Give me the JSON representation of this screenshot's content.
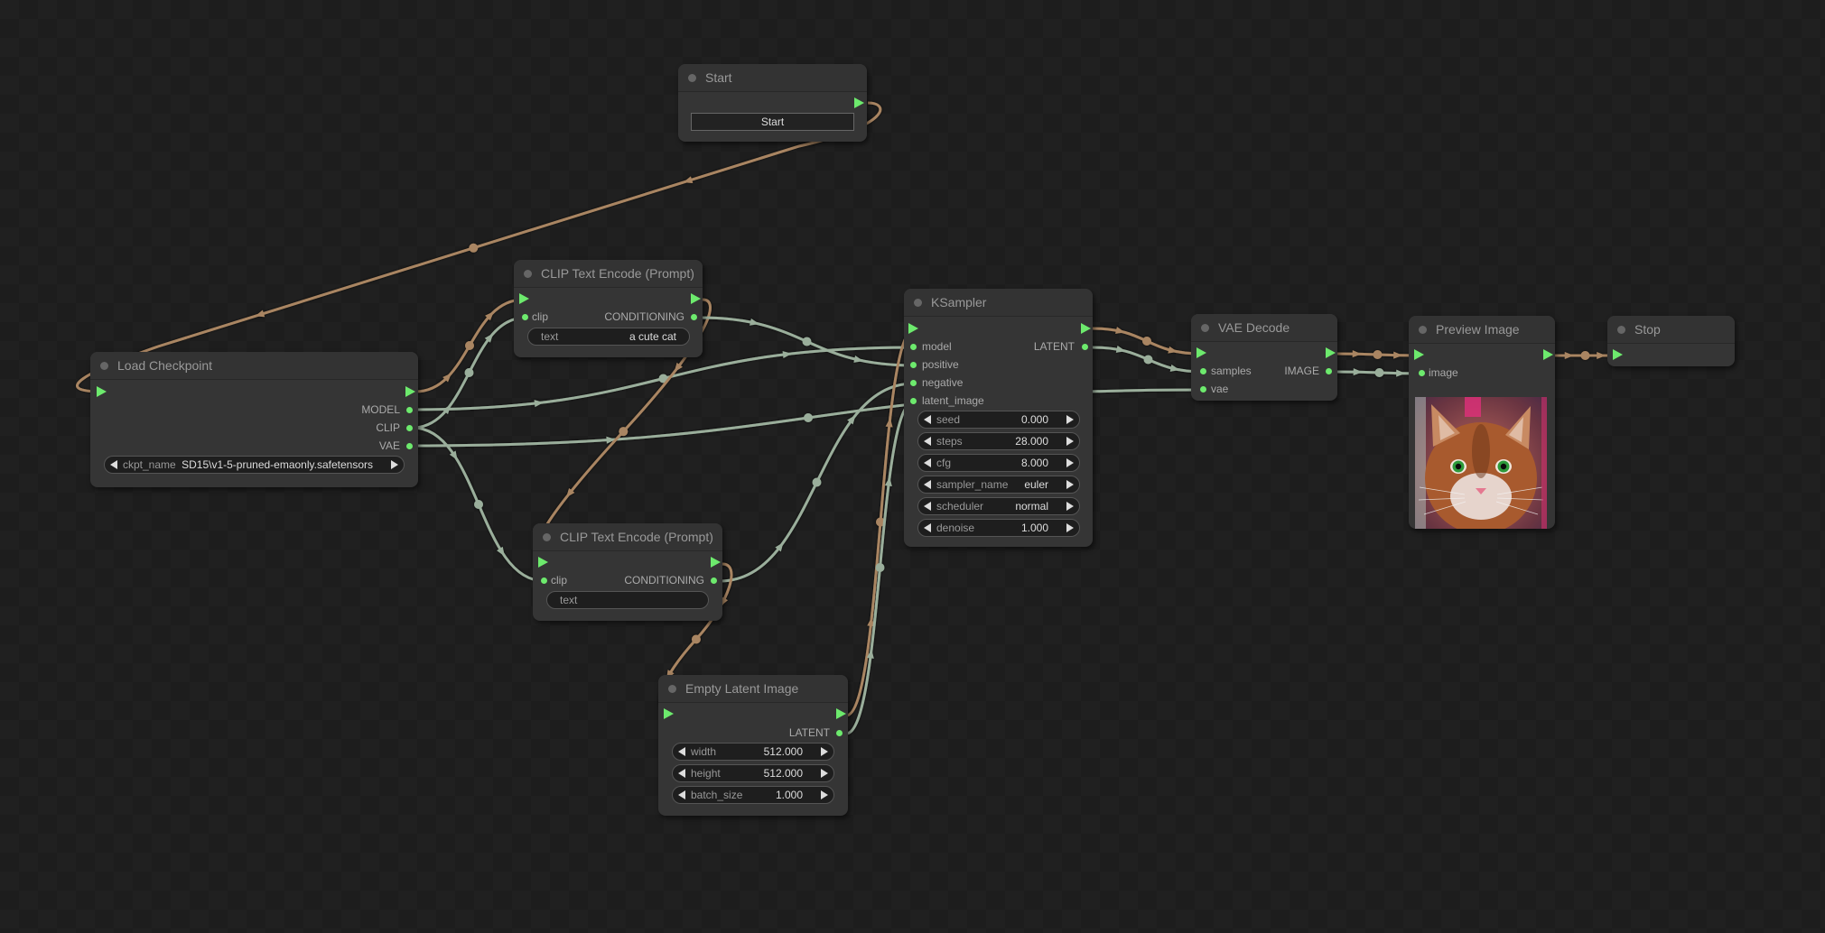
{
  "canvas": {
    "link_colors": {
      "exec": "#a98562",
      "data": "#9aae9b"
    },
    "slot_color": "#6dea6d"
  },
  "nodes": {
    "start": {
      "title": "Start",
      "button_label": "Start"
    },
    "load_checkpoint": {
      "title": "Load Checkpoint",
      "outputs": [
        "MODEL",
        "CLIP",
        "VAE"
      ],
      "widgets": [
        {
          "label": "ckpt_name",
          "value": "SD15\\v1-5-pruned-emaonly.safetensors"
        }
      ]
    },
    "clip_encode_positive": {
      "title": "CLIP Text Encode (Prompt)",
      "inputs": [
        "clip"
      ],
      "outputs": [
        "CONDITIONING"
      ],
      "widgets": [
        {
          "label": "text",
          "value": "a cute cat"
        }
      ]
    },
    "clip_encode_negative": {
      "title": "CLIP Text Encode (Prompt)",
      "inputs": [
        "clip"
      ],
      "outputs": [
        "CONDITIONING"
      ],
      "widgets": [
        {
          "label": "text",
          "value": ""
        }
      ]
    },
    "ksampler": {
      "title": "KSampler",
      "inputs": [
        "model",
        "positive",
        "negative",
        "latent_image"
      ],
      "outputs": [
        "LATENT"
      ],
      "widgets": [
        {
          "label": "seed",
          "value": "0.000"
        },
        {
          "label": "steps",
          "value": "28.000"
        },
        {
          "label": "cfg",
          "value": "8.000"
        },
        {
          "label": "sampler_name",
          "value": "euler"
        },
        {
          "label": "scheduler",
          "value": "normal"
        },
        {
          "label": "denoise",
          "value": "1.000"
        }
      ]
    },
    "empty_latent": {
      "title": "Empty Latent Image",
      "outputs": [
        "LATENT"
      ],
      "widgets": [
        {
          "label": "width",
          "value": "512.000"
        },
        {
          "label": "height",
          "value": "512.000"
        },
        {
          "label": "batch_size",
          "value": "1.000"
        }
      ]
    },
    "vae_decode": {
      "title": "VAE Decode",
      "inputs": [
        "samples",
        "vae"
      ],
      "outputs": [
        "IMAGE"
      ]
    },
    "preview_image": {
      "title": "Preview Image",
      "inputs": [
        "image"
      ],
      "image_alt": "cat-preview"
    },
    "stop": {
      "title": "Stop"
    }
  }
}
